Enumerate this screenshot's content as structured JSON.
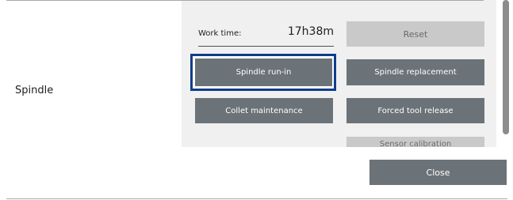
{
  "row": {
    "label": "Spindle"
  },
  "work_time": {
    "label": "Work time:",
    "value": "17h38m"
  },
  "buttons": {
    "reset": "Reset",
    "spindle_run_in": "Spindle run-in",
    "spindle_replacement": "Spindle replacement",
    "collet_maintenance": "Collet maintenance",
    "forced_tool_release": "Forced tool release",
    "partial_next": "Sensor calibration"
  },
  "footer": {
    "close": "Close"
  },
  "colors": {
    "button": "#6b7378",
    "button_disabled": "#c9c9c9",
    "focus_ring": "#0f3d8c",
    "panel": "#f0f0f0"
  }
}
